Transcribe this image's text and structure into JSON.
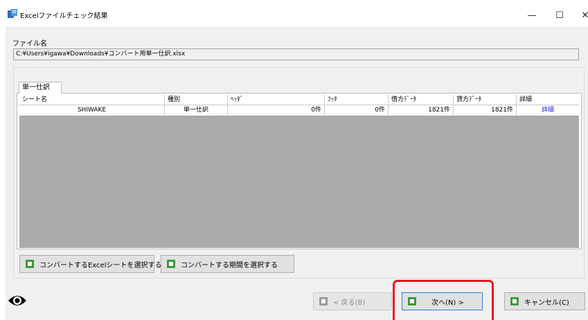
{
  "window": {
    "title": "Excelファイルチェック結果",
    "min_glyph": "—",
    "max_glyph": "☐",
    "close_glyph": "✕"
  },
  "file": {
    "label": "ファイル名",
    "path": "C:¥Users¥igawa¥Downloads¥コンバート用単一仕訳.xlsx"
  },
  "tab": {
    "label": "単一仕訳"
  },
  "table": {
    "headers": [
      "シート名",
      "種別",
      "ﾍｯﾀﾞ",
      "ﾌｯﾀ",
      "借方ﾃﾞｰﾀ",
      "貸方ﾃﾞｰﾀ",
      "詳細"
    ],
    "rows": [
      [
        "SHIWAKE",
        "単一仕訳",
        "0件",
        "0件",
        "1821件",
        "1821件",
        "詳細"
      ]
    ]
  },
  "buttons": {
    "select_sheet": "コンバートするExcelシートを選択する",
    "select_period": "コンバートする期間を選択する",
    "back": "< 戻る(B)",
    "next": "次へ(N) >",
    "cancel": "キャンセル(C)"
  },
  "colors": {
    "highlight": "#e8131e",
    "link": "#1a1ad6",
    "grid_background": "#ababab"
  }
}
